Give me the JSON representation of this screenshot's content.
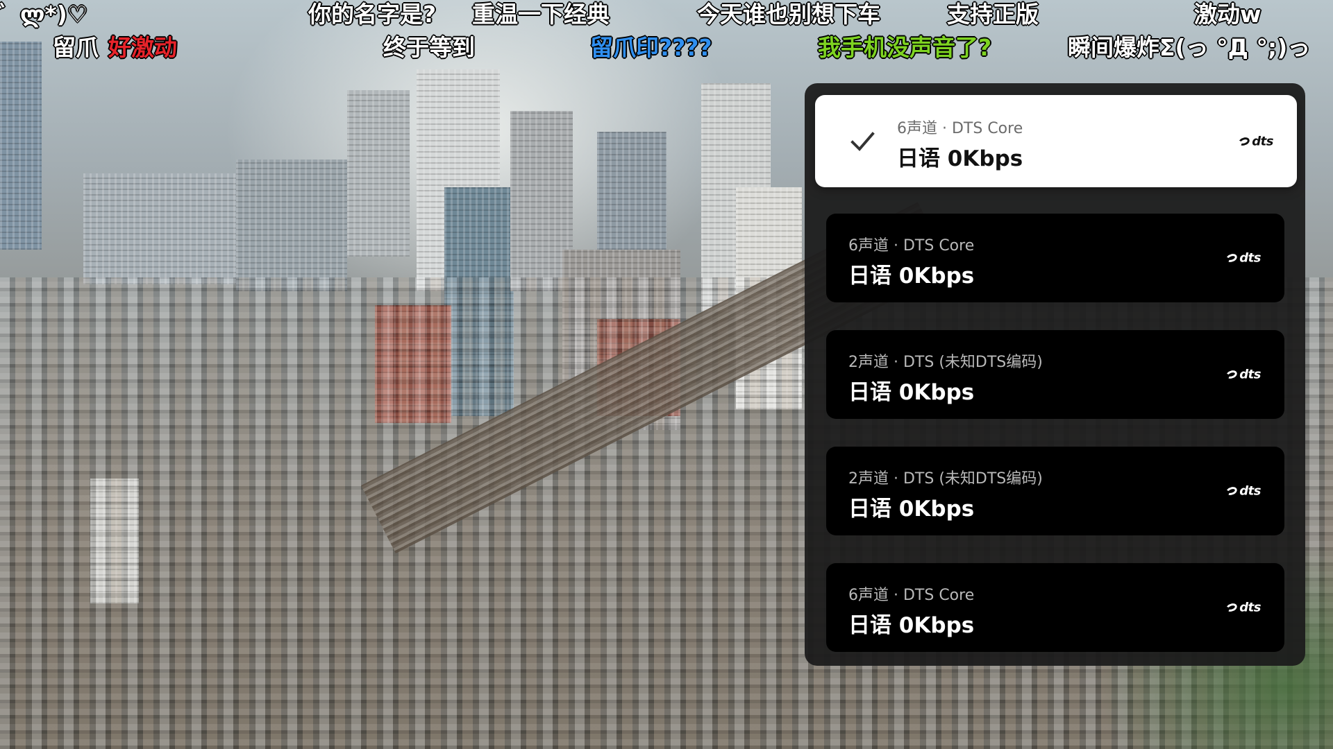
{
  "danmaku": [
    {
      "text": "゛ლ*)♡",
      "color": "#ffffff"
    },
    {
      "text": "你的名字是?",
      "color": "#ffffff"
    },
    {
      "text": "重温一下经典",
      "color": "#ffffff"
    },
    {
      "text": "今天谁也别想下车",
      "color": "#ffffff"
    },
    {
      "text": "支持正版",
      "color": "#ffffff"
    },
    {
      "text": "激动w",
      "color": "#ffffff"
    },
    {
      "text": "留爪",
      "color": "#ffffff"
    },
    {
      "text": "好激动",
      "color": "#e8232a"
    },
    {
      "text": "终于等到",
      "color": "#ffffff"
    },
    {
      "text": "留爪印????",
      "color": "#2f8ff0"
    },
    {
      "text": "我手机没声音了?",
      "color": "#7ed321"
    },
    {
      "text": "瞬间爆炸Σ(っ °Д °;)っ",
      "color": "#ffffff"
    }
  ],
  "audio_tracks": [
    {
      "meta": "6声道 · DTS Core",
      "label": "日语 0Kbps",
      "logo": "dts",
      "selected": true
    },
    {
      "meta": "6声道 · DTS Core",
      "label": "日语 0Kbps",
      "logo": "dts",
      "selected": false
    },
    {
      "meta": "2声道 · DTS (未知DTS编码)",
      "label": "日语 0Kbps",
      "logo": "dts",
      "selected": false
    },
    {
      "meta": "2声道 · DTS (未知DTS编码)",
      "label": "日语 0Kbps",
      "logo": "dts",
      "selected": false
    },
    {
      "meta": "6声道 · DTS Core",
      "label": "日语 0Kbps",
      "logo": "dts",
      "selected": false
    }
  ],
  "icons": {
    "selected_marker": "checkmark-icon",
    "codec_logo": "dts-logo-icon"
  },
  "colors": {
    "panel_bg": "#1c1c1c",
    "track_bg": "#000000",
    "selected_bg": "#ffffff"
  }
}
